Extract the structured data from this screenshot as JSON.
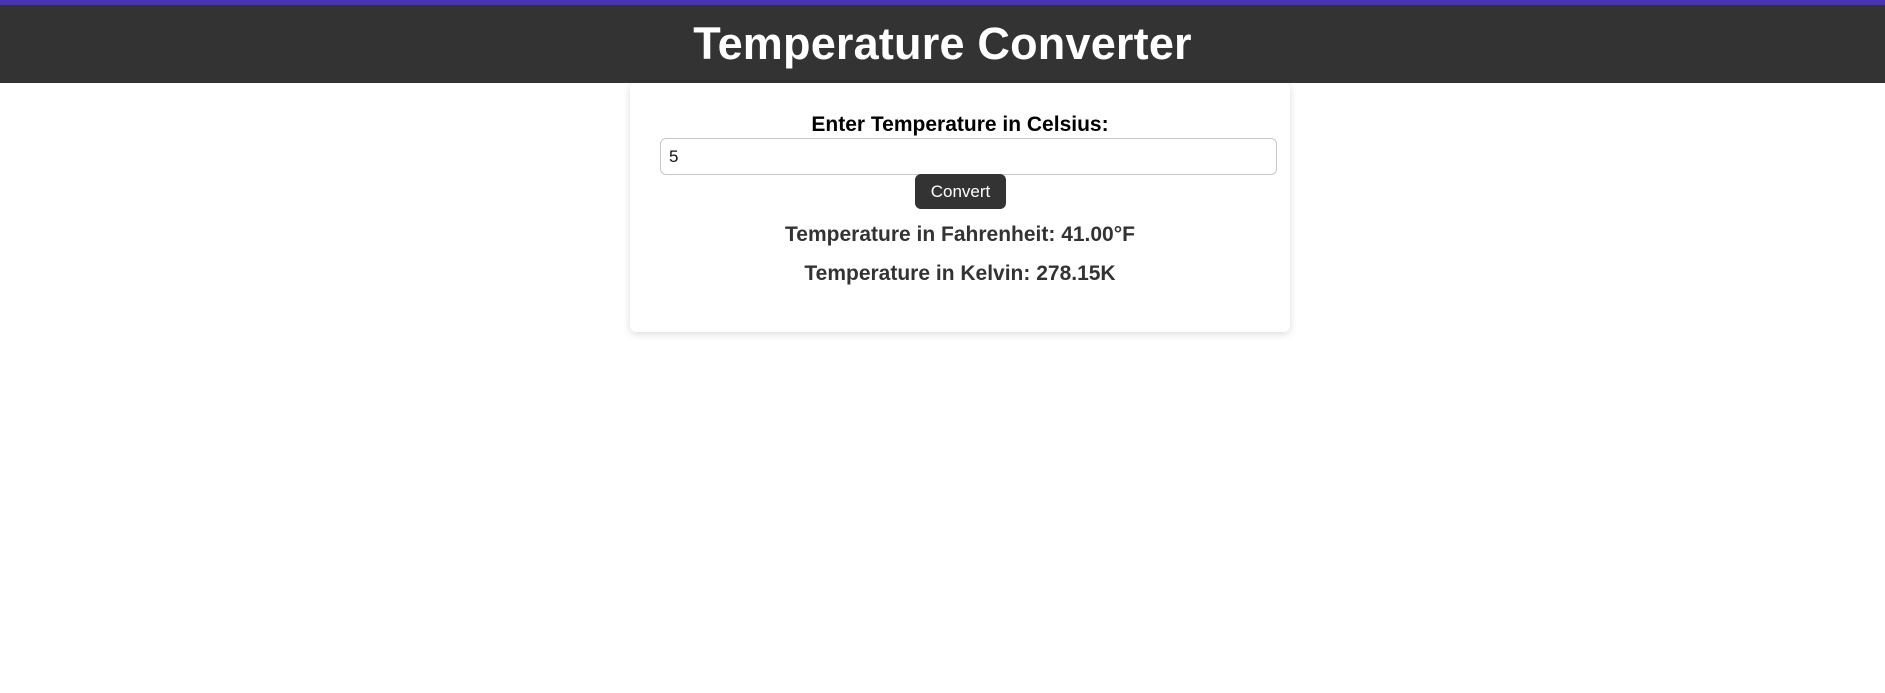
{
  "header": {
    "title": "Temperature Converter"
  },
  "form": {
    "label": "Enter Temperature in Celsius:",
    "input_value": "5",
    "button_label": "Convert"
  },
  "results": {
    "fahrenheit": "Temperature in Fahrenheit: 41.00°F",
    "kelvin": "Temperature in Kelvin: 278.15K"
  },
  "colors": {
    "header_bg": "#333333",
    "accent_bar": "#4a33b0",
    "button_bg": "#333333"
  }
}
